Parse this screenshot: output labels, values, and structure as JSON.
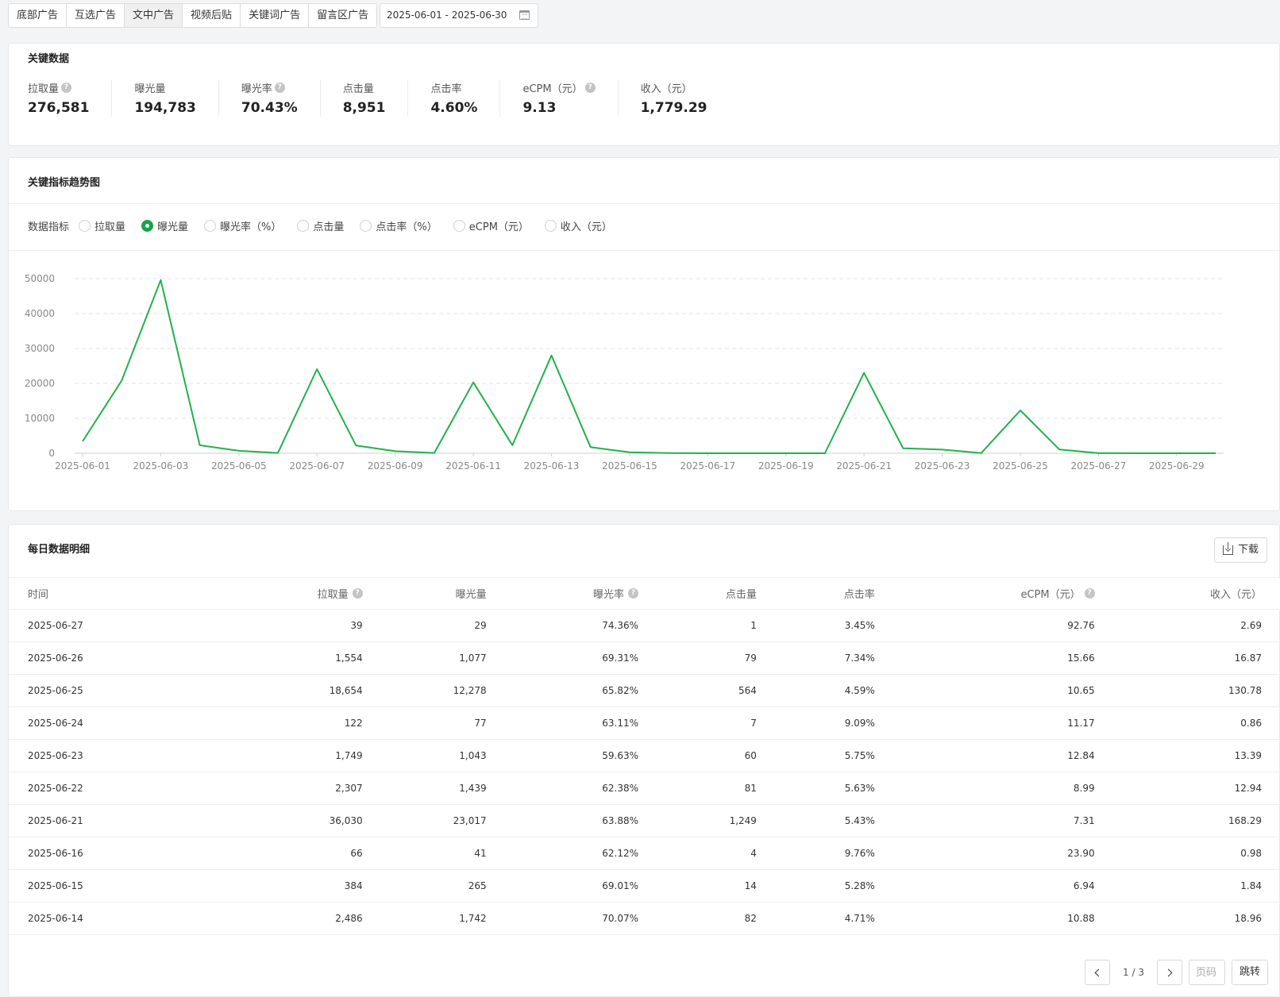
{
  "tabs": [
    {
      "label": "底部广告",
      "active": false
    },
    {
      "label": "互选广告",
      "active": false
    },
    {
      "label": "文中广告",
      "active": true
    },
    {
      "label": "视频后贴",
      "active": false
    },
    {
      "label": "关键词广告",
      "active": false
    },
    {
      "label": "留言区广告",
      "active": false
    }
  ],
  "date_range": "2025-06-01 - 2025-06-30",
  "key_data": {
    "title": "关键数据",
    "metrics": [
      {
        "label": "拉取量",
        "value": "276,581",
        "help": true
      },
      {
        "label": "曝光量",
        "value": "194,783",
        "help": false
      },
      {
        "label": "曝光率",
        "value": "70.43%",
        "help": true
      },
      {
        "label": "点击量",
        "value": "8,951",
        "help": false
      },
      {
        "label": "点击率",
        "value": "4.60%",
        "help": false
      },
      {
        "label": "eCPM（元）",
        "value": "9.13",
        "help": true
      },
      {
        "label": "收入（元）",
        "value": "1,779.29",
        "help": false
      }
    ]
  },
  "trend": {
    "title": "关键指标趋势图",
    "indicator_label": "数据指标",
    "indicators": [
      {
        "label": "拉取量",
        "checked": false
      },
      {
        "label": "曝光量",
        "checked": true
      },
      {
        "label": "曝光率（%）",
        "checked": false
      },
      {
        "label": "点击量",
        "checked": false
      },
      {
        "label": "点击率（%）",
        "checked": false
      },
      {
        "label": "eCPM（元）",
        "checked": false
      },
      {
        "label": "收入（元）",
        "checked": false
      }
    ]
  },
  "chart_data": {
    "type": "line",
    "x": [
      "2025-06-01",
      "2025-06-02",
      "2025-06-03",
      "2025-06-04",
      "2025-06-05",
      "2025-06-06",
      "2025-06-07",
      "2025-06-08",
      "2025-06-09",
      "2025-06-10",
      "2025-06-11",
      "2025-06-12",
      "2025-06-13",
      "2025-06-14",
      "2025-06-15",
      "2025-06-16",
      "2025-06-17",
      "2025-06-18",
      "2025-06-19",
      "2025-06-20",
      "2025-06-21",
      "2025-06-22",
      "2025-06-23",
      "2025-06-24",
      "2025-06-25",
      "2025-06-26",
      "2025-06-27",
      "2025-06-28",
      "2025-06-29",
      "2025-06-30"
    ],
    "x_tick_labels": [
      "2025-06-01",
      "2025-06-03",
      "2025-06-05",
      "2025-06-07",
      "2025-06-09",
      "2025-06-11",
      "2025-06-13",
      "2025-06-15",
      "2025-06-17",
      "2025-06-19",
      "2025-06-21",
      "2025-06-23",
      "2025-06-25",
      "2025-06-27",
      "2025-06-29"
    ],
    "series": [
      {
        "values": [
          3400,
          20800,
          49600,
          2300,
          700,
          100,
          24100,
          2200,
          600,
          100,
          20300,
          2300,
          28000,
          1742,
          265,
          41,
          0,
          0,
          0,
          0,
          23017,
          1439,
          1043,
          77,
          12278,
          1077,
          29,
          0,
          0,
          0
        ]
      }
    ],
    "ylim": [
      0,
      50000
    ],
    "y_ticks": [
      "0",
      "10000",
      "20000",
      "30000",
      "40000",
      "50000"
    ],
    "grid": true,
    "color": "#22b14c"
  },
  "daily": {
    "title": "每日数据明细",
    "download_label": "下载",
    "columns": [
      {
        "label": "时间",
        "help": false
      },
      {
        "label": "拉取量",
        "help": true
      },
      {
        "label": "曝光量",
        "help": false
      },
      {
        "label": "曝光率",
        "help": true
      },
      {
        "label": "点击量",
        "help": false
      },
      {
        "label": "点击率",
        "help": false
      },
      {
        "label": "eCPM（元）",
        "help": true
      },
      {
        "label": "收入（元）",
        "help": false
      }
    ],
    "rows": [
      [
        "2025-06-27",
        "39",
        "29",
        "74.36%",
        "1",
        "3.45%",
        "92.76",
        "2.69"
      ],
      [
        "2025-06-26",
        "1,554",
        "1,077",
        "69.31%",
        "79",
        "7.34%",
        "15.66",
        "16.87"
      ],
      [
        "2025-06-25",
        "18,654",
        "12,278",
        "65.82%",
        "564",
        "4.59%",
        "10.65",
        "130.78"
      ],
      [
        "2025-06-24",
        "122",
        "77",
        "63.11%",
        "7",
        "9.09%",
        "11.17",
        "0.86"
      ],
      [
        "2025-06-23",
        "1,749",
        "1,043",
        "59.63%",
        "60",
        "5.75%",
        "12.84",
        "13.39"
      ],
      [
        "2025-06-22",
        "2,307",
        "1,439",
        "62.38%",
        "81",
        "5.63%",
        "8.99",
        "12.94"
      ],
      [
        "2025-06-21",
        "36,030",
        "23,017",
        "63.88%",
        "1,249",
        "5.43%",
        "7.31",
        "168.29"
      ],
      [
        "2025-06-16",
        "66",
        "41",
        "62.12%",
        "4",
        "9.76%",
        "23.90",
        "0.98"
      ],
      [
        "2025-06-15",
        "384",
        "265",
        "69.01%",
        "14",
        "5.28%",
        "6.94",
        "1.84"
      ],
      [
        "2025-06-14",
        "2,486",
        "1,742",
        "70.07%",
        "82",
        "4.71%",
        "10.88",
        "18.96"
      ]
    ],
    "pagination": {
      "info": "1 / 3",
      "page_placeholder": "页码",
      "jump_label": "跳转"
    }
  }
}
